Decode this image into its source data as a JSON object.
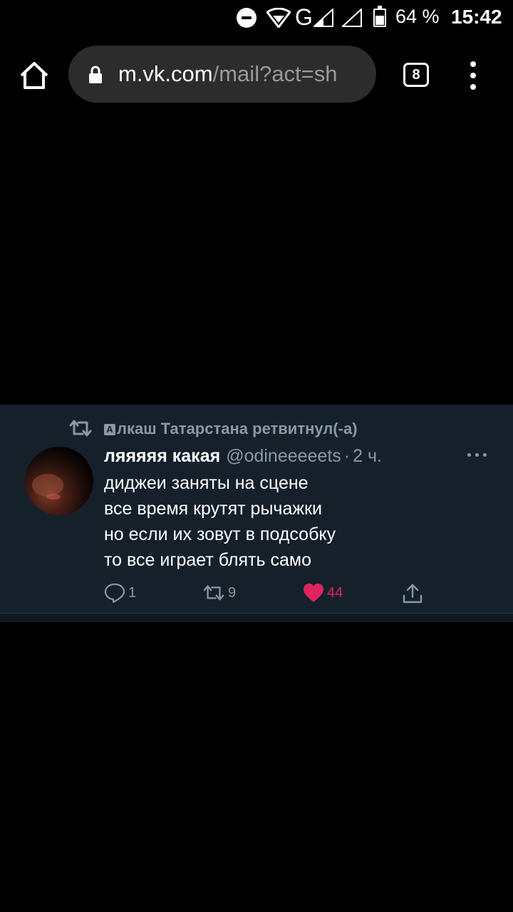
{
  "status_bar": {
    "network": "G",
    "battery_percent": "64 %",
    "battery_level": 0.64,
    "time": "15:42"
  },
  "browser": {
    "url_host": "m.vk.com",
    "url_path": "/mail?act=sh",
    "tab_count": "8",
    "icons": [
      "home-icon",
      "lock-icon",
      "tabs-icon",
      "more-vertical-icon"
    ]
  },
  "tweet": {
    "retweet_badge": "А",
    "retweet_text": "лкаш Татарстана ретвитнул(-а)",
    "display_name": "ляяяяя какая",
    "handle": "@odineeeeets",
    "separator": "·",
    "time": "2 ч.",
    "lines": [
      "диджеи заняты на сцене",
      "все время крутят рычажки",
      "но если их зовут в подсобку",
      "то все играет блять само"
    ],
    "replies": "1",
    "retweets": "9",
    "likes": "44",
    "like_color": "#e0245e",
    "background_color": "#15202b",
    "muted_color": "#8899a6"
  }
}
